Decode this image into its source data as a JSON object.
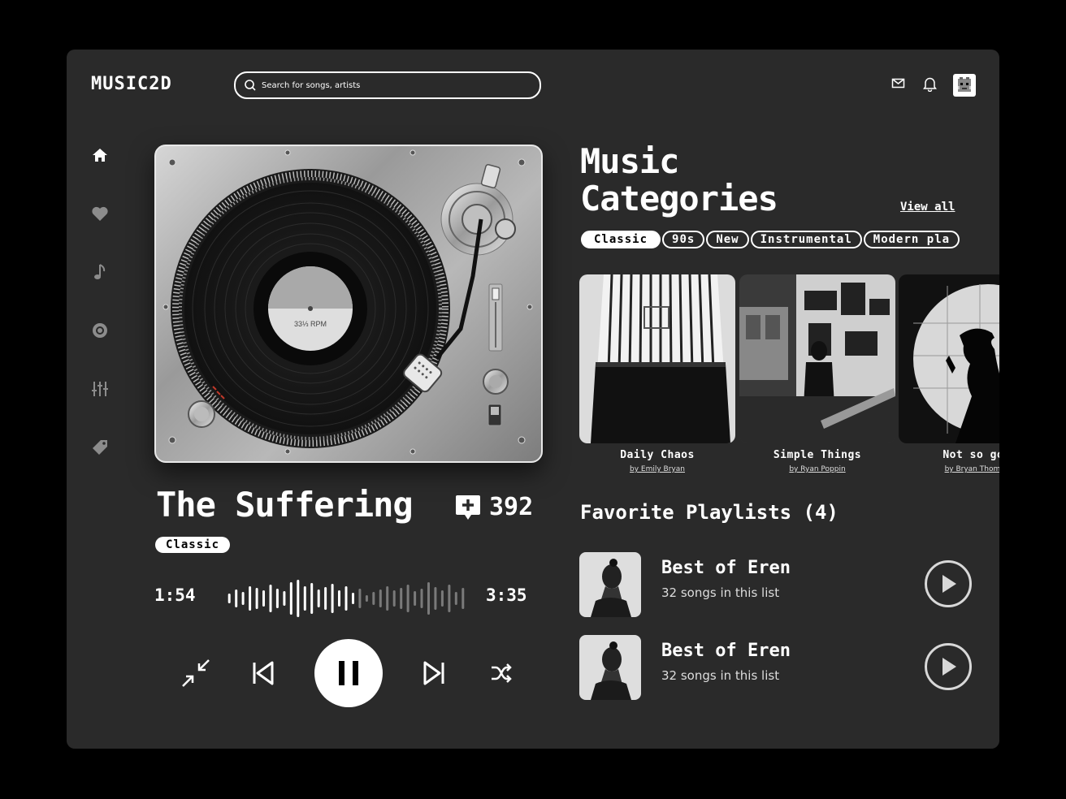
{
  "app": {
    "logo": "MUSIC2D"
  },
  "search": {
    "placeholder": "Search for songs, artists"
  },
  "header_icons": [
    "mail-icon",
    "bell-icon",
    "avatar"
  ],
  "sidebar": {
    "items": [
      "home-icon",
      "heart-icon",
      "music-note-icon",
      "disc-icon",
      "sliders-icon",
      "tag-icon"
    ]
  },
  "turntable": {
    "label": "33⅓ RPM"
  },
  "now_playing": {
    "title": "The Suffering",
    "comments": "392",
    "genre": "Classic",
    "elapsed": "1:54",
    "duration": "3:35",
    "progress": 0.53
  },
  "categories": {
    "title_line1": "Music",
    "title_line2": "Categories",
    "view_all": "View all",
    "chips": [
      {
        "label": "Classic",
        "active": true
      },
      {
        "label": "90s",
        "active": false
      },
      {
        "label": "New",
        "active": false
      },
      {
        "label": "Instrumental",
        "active": false
      },
      {
        "label": "Modern pla",
        "active": false
      }
    ],
    "cards": [
      {
        "name": "Daily Chaos",
        "by": "by Emily Bryan"
      },
      {
        "name": "Simple Things",
        "by": "by Ryan Poppin"
      },
      {
        "name": "Not so goo",
        "by": "by Bryan Thomas"
      }
    ]
  },
  "favorites": {
    "title": "Favorite Playlists (4)",
    "items": [
      {
        "name": "Best of Eren",
        "count": "32 songs in this list"
      },
      {
        "name": "Best of Eren",
        "count": "32 songs in this list"
      }
    ]
  },
  "colors": {
    "background": "#000000",
    "panel": "#2a2a2a",
    "accent": "#ffffff"
  }
}
